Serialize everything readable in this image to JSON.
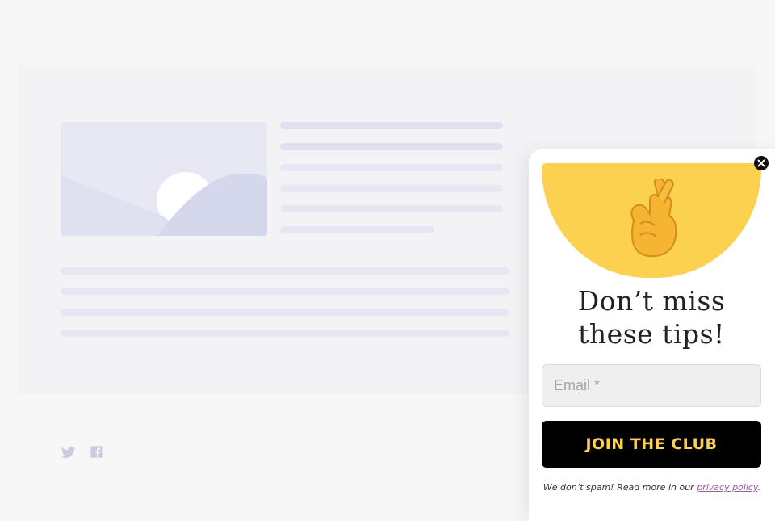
{
  "popup": {
    "title_line1": "Don’t miss",
    "title_line2": "these tips!",
    "email_placeholder": "Email *",
    "button_label": "JOIN THE CLUB",
    "note_text": "We don’t spam! Read more in our",
    "note_link": "privacy policy",
    "note_end": ".",
    "hero_icon": "crossed-fingers-icon",
    "accent_color": "#fdd150"
  },
  "social": {
    "icons": [
      "twitter-icon",
      "facebook-icon"
    ],
    "color": "#c9cbe0"
  }
}
